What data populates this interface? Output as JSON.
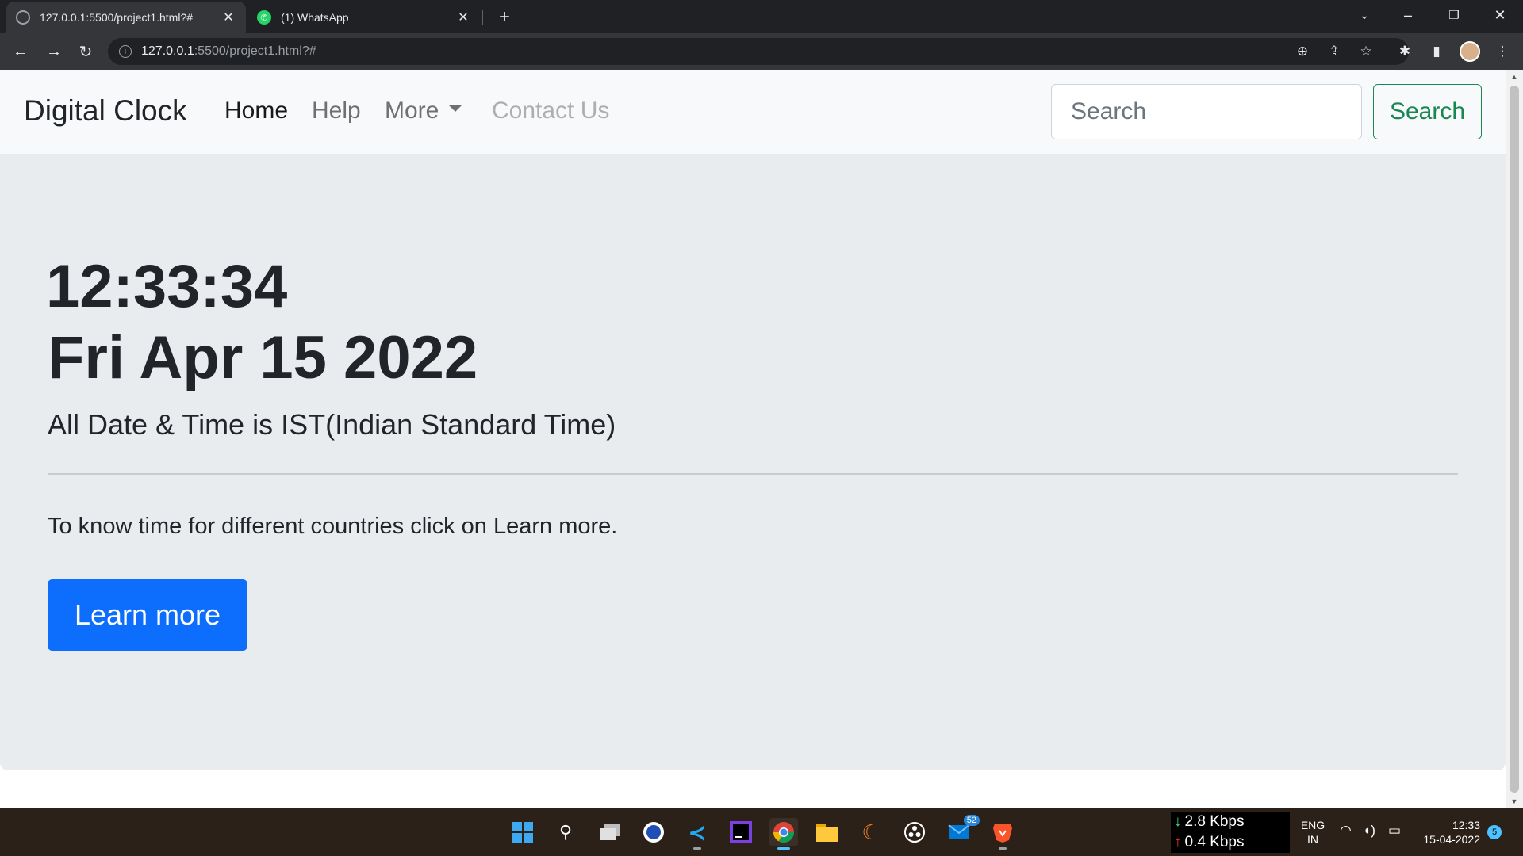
{
  "browser": {
    "tabs": [
      {
        "title": "127.0.0.1:5500/project1.html?#",
        "icon": "globe-icon",
        "active": true
      },
      {
        "title": "(1) WhatsApp",
        "icon": "whatsapp-icon",
        "active": false
      }
    ],
    "url_host": "127.0.0.1",
    "url_path": ":5500/project1.html?#"
  },
  "navbar": {
    "brand": "Digital Clock",
    "links": [
      "Home",
      "Help",
      "More",
      "Contact Us"
    ],
    "search_placeholder": "Search",
    "search_button": "Search"
  },
  "main": {
    "time": "12:33:34",
    "date": "Fri Apr 15 2022",
    "lead": "All Date & Time is IST(Indian Standard Time)",
    "info": "To know time for different countries click on Learn more.",
    "button": "Learn more"
  },
  "taskbar": {
    "apps": [
      "windows-start-icon",
      "search-icon",
      "task-view-icon",
      "word-icon",
      "vscode-icon",
      "intellij-icon",
      "chrome-icon",
      "file-explorer-icon",
      "eclipse-icon",
      "obs-icon",
      "mail-icon",
      "brave-icon"
    ],
    "mail_badge": "52",
    "net_down": "2.8 Kbps",
    "net_up": "0.4 Kbps",
    "lang_1": "ENG",
    "lang_2": "IN",
    "time": "12:33",
    "date": "15-04-2022",
    "notifications": "5"
  },
  "colors": {
    "primary": "#0d6efd",
    "success": "#198754",
    "jumbotron_bg": "#e9ecef",
    "navbar_bg": "#f8f9fa"
  }
}
